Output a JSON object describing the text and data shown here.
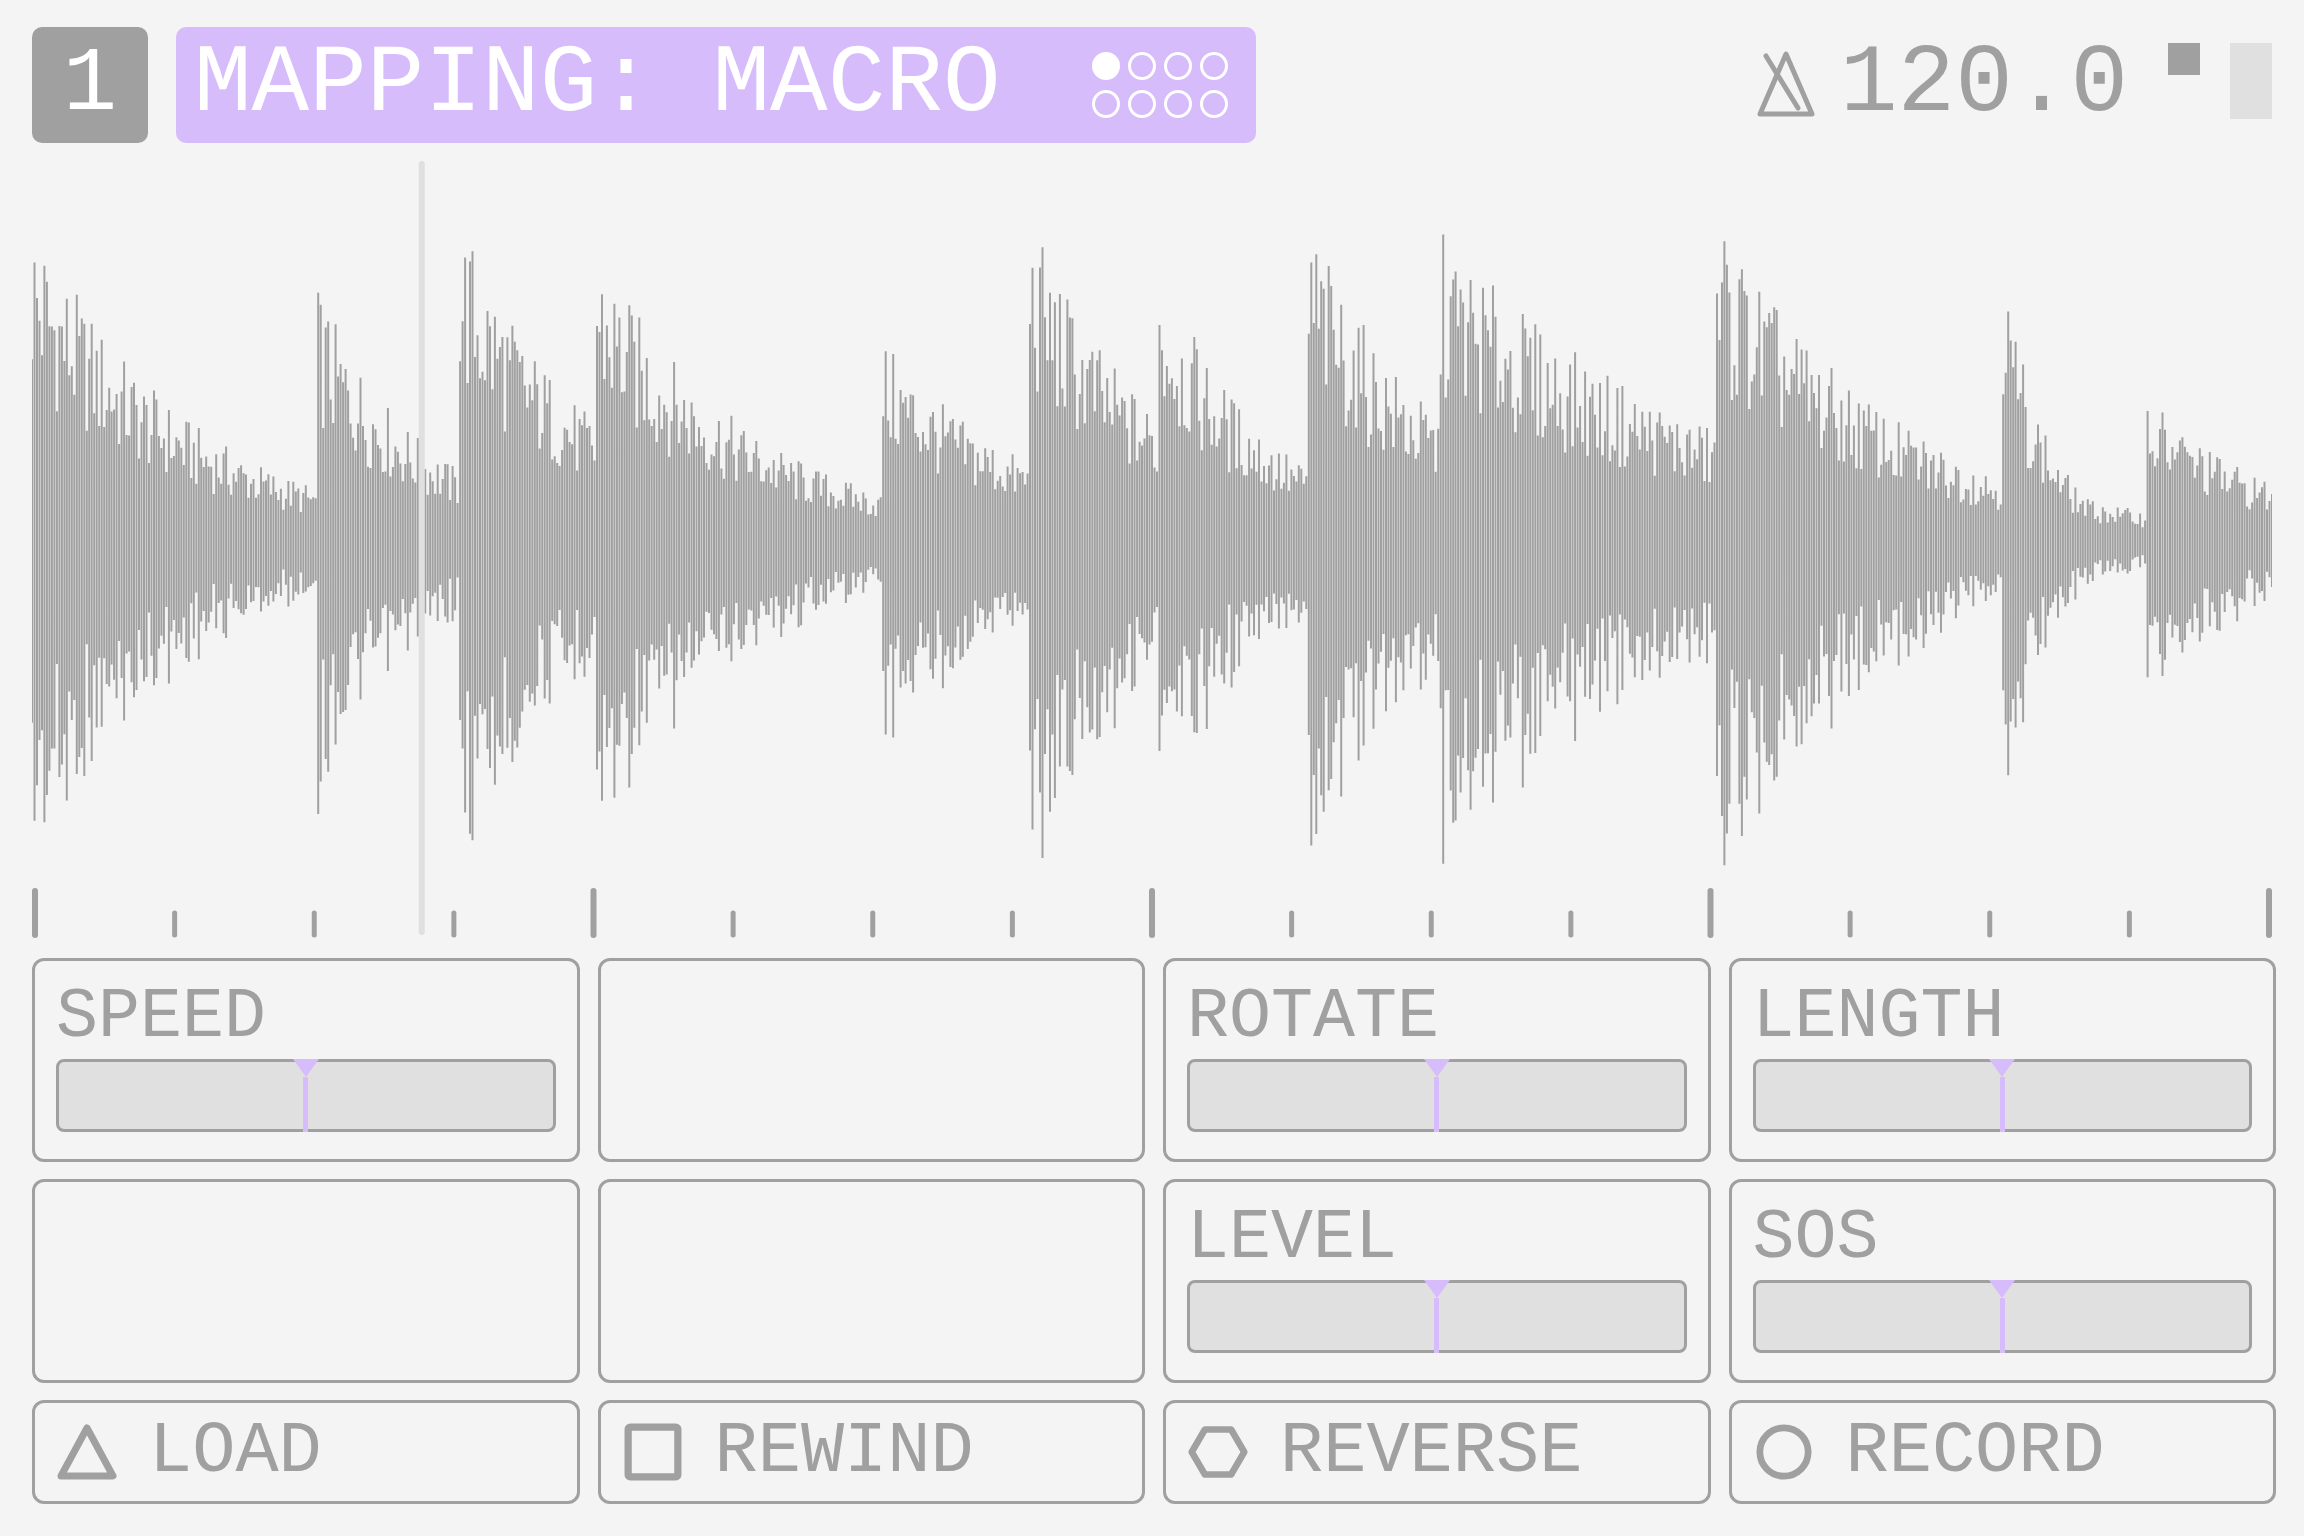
{
  "track": {
    "number": "1"
  },
  "mapping": {
    "label": "MAPPING: MACRO",
    "pages": [
      {
        "selected": true
      },
      {
        "selected": false
      },
      {
        "selected": false
      },
      {
        "selected": false
      },
      {
        "selected": false
      },
      {
        "selected": false
      },
      {
        "selected": false
      },
      {
        "selected": false
      }
    ]
  },
  "tempo": {
    "bpm": "120.0"
  },
  "playback": {
    "level": 0.174
  },
  "controls": [
    {
      "kind": "slider",
      "label": "SPEED",
      "level": 0.5
    },
    {
      "kind": "empty"
    },
    {
      "kind": "slider",
      "label": "ROTATE",
      "level": 0.5
    },
    {
      "kind": "slider",
      "label": "LENGTH",
      "level": 0.5
    },
    {
      "kind": "empty"
    },
    {
      "kind": "empty"
    },
    {
      "kind": "slider",
      "label": "LEVEL",
      "level": 0.5
    },
    {
      "kind": "slider",
      "label": "SOS",
      "level": 0.5
    }
  ],
  "buttons": [
    {
      "label": "LOAD"
    },
    {
      "label": "REWIND"
    },
    {
      "label": "REVERSE"
    },
    {
      "label": "RECORD"
    }
  ]
}
